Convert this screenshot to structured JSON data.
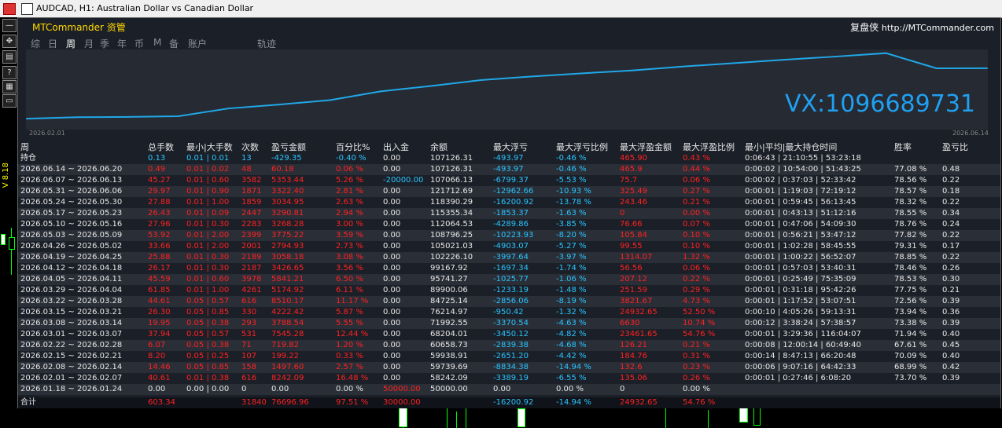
{
  "window": {
    "title": "AUDCAD, H1:  Australian Dollar vs Canadian Dollar"
  },
  "toolbar_buttons": [
    "—",
    "✥",
    "▤",
    "?",
    "▦",
    "▭"
  ],
  "side_text": "V 8.18",
  "panel": {
    "brand": "MTCommander 资管",
    "site_name": "复盘侠",
    "site_url": "http://MTCommander.com",
    "tabs": [
      "综",
      "日",
      "周",
      "月",
      "季",
      "年",
      "币",
      "M",
      "备",
      "账户",
      "轨迹"
    ],
    "active_tab": "周"
  },
  "chart_data": {
    "type": "line",
    "x_ticks": [
      "2026.02.01",
      "2026.06.14"
    ],
    "watermark": "VX:1096689731",
    "x": [
      "2026.02.01",
      "2026.02.08",
      "2026.02.15",
      "2026.02.22",
      "2026.03.01",
      "2026.03.08",
      "2026.03.15",
      "2026.03.22",
      "2026.03.29",
      "2026.04.05",
      "2026.04.12",
      "2026.04.19",
      "2026.04.26",
      "2026.05.03",
      "2026.05.10",
      "2026.05.17",
      "2026.05.24",
      "2026.05.31",
      "2026.06.07",
      "2026.06.14"
    ],
    "values": [
      58242.09,
      59739.69,
      59938.91,
      60658.73,
      68204.01,
      71992.55,
      76214.97,
      84725.14,
      89900.06,
      95741.27,
      99167.92,
      102226.1,
      105021.03,
      108796.25,
      112064.53,
      115355.34,
      118390.29,
      121712.69,
      107066.13,
      107126.31
    ],
    "color": "#20a8e8"
  },
  "table": {
    "headers": [
      "周",
      "总手数",
      "最小|大手数",
      "次数",
      "盈亏金额",
      "百分比%",
      "出入金",
      "余额",
      "最大浮亏",
      "最大浮亏比例",
      "最大浮盈金额",
      "最大浮盈比例",
      "最小|平均|最大持仓时间",
      "胜率",
      "盈亏比"
    ],
    "holding": [
      "持仓",
      "0.13",
      "0.01 | 0.01",
      "13",
      "-429.35",
      "-0.40 %",
      "0.00",
      "107126.31",
      "-493.97",
      "-0.46 %",
      "465.90",
      "0.43 %",
      "0:06:43 | 21:10:55 | 53:23:18",
      "",
      ""
    ],
    "rows": [
      [
        "2026.06.14 ~ 2026.06.20",
        "0.49",
        "0.01 | 0.02",
        "48",
        "60.18",
        "0.06 %",
        "0.00",
        "107126.31",
        "-493.97",
        "-0.46 %",
        "465.9",
        "0.44 %",
        "0:00:02 | 10:54:00 | 51:43:25",
        "77.08 %",
        "0.48"
      ],
      [
        "2026.06.07 ~ 2026.06.13",
        "45.27",
        "0.01 | 0.60",
        "3582",
        "5353.44",
        "5.26 %",
        "-20000.00",
        "107066.13",
        "-6799.37",
        "-5.53 %",
        "75.7",
        "0.06 %",
        "0:00:02 | 0:37:03 | 52:33:42",
        "78.56 %",
        "0.22"
      ],
      [
        "2026.05.31 ~ 2026.06.06",
        "29.97",
        "0.01 | 0.90",
        "1871",
        "3322.40",
        "2.81 %",
        "0.00",
        "121712.69",
        "-12962.66",
        "-10.93 %",
        "325.49",
        "0.27 %",
        "0:00:01 | 1:19:03 | 72:19:12",
        "78.57 %",
        "0.18"
      ],
      [
        "2026.05.24 ~ 2026.05.30",
        "27.88",
        "0.01 | 1.00",
        "1859",
        "3034.95",
        "2.63 %",
        "0.00",
        "118390.29",
        "-16200.92",
        "-13.78 %",
        "243.46",
        "0.21 %",
        "0:00:01 | 0:59:45 | 56:13:45",
        "78.32 %",
        "0.22"
      ],
      [
        "2026.05.17 ~ 2026.05.23",
        "26.43",
        "0.01 | 0.09",
        "2447",
        "3290.81",
        "2.94 %",
        "0.00",
        "115355.34",
        "-1853.37",
        "-1.63 %",
        "0",
        "0.00 %",
        "0:00:01 | 0:43:13 | 51:12:16",
        "78.55 %",
        "0.34"
      ],
      [
        "2026.05.10 ~ 2026.05.16",
        "27.96",
        "0.01 | 0.30",
        "2283",
        "3268.28",
        "3.00 %",
        "0.00",
        "112064.53",
        "-4289.86",
        "-3.85 %",
        "76.66",
        "0.07 %",
        "0:00:01 | 0:47:06 | 54:09:30",
        "78.76 %",
        "0.24"
      ],
      [
        "2026.05.03 ~ 2026.05.09",
        "53.92",
        "0.01 | 2.00",
        "2399",
        "3775.22",
        "3.59 %",
        "0.00",
        "108796.25",
        "-10223.93",
        "-8.20 %",
        "105.84",
        "0.10 %",
        "0:00:01 | 0:56:21 | 53:47:12",
        "77.82 %",
        "0.22"
      ],
      [
        "2026.04.26 ~ 2026.05.02",
        "33.66",
        "0.01 | 2.00",
        "2001",
        "2794.93",
        "2.73 %",
        "0.00",
        "105021.03",
        "-4903.07",
        "-5.27 %",
        "99.55",
        "0.10 %",
        "0:00:01 | 1:02:28 | 58:45:55",
        "79.31 %",
        "0.17"
      ],
      [
        "2026.04.19 ~ 2026.04.25",
        "25.88",
        "0.01 | 0.30",
        "2189",
        "3058.18",
        "3.08 %",
        "0.00",
        "102226.10",
        "-3997.64",
        "-3.97 %",
        "1314.07",
        "1.32 %",
        "0:00:01 | 1:00:22 | 56:52:07",
        "78.85 %",
        "0.22"
      ],
      [
        "2026.04.12 ~ 2026.04.18",
        "26.17",
        "0.01 | 0.30",
        "2187",
        "3426.65",
        "3.56 %",
        "0.00",
        "99167.92",
        "-1697.34",
        "-1.74 %",
        "56.56",
        "0.06 %",
        "0:00:01 | 0:57:03 | 53:40:31",
        "78.46 %",
        "0.26"
      ],
      [
        "2026.04.05 ~ 2026.04.11",
        "45.59",
        "0.01 | 0.60",
        "3978",
        "5841.21",
        "6.50 %",
        "0.00",
        "95741.27",
        "-1025.77",
        "-1.06 %",
        "207.12",
        "0.22 %",
        "0:00:01 | 0:25:49 | 75:35:09",
        "78.53 %",
        "0.30"
      ],
      [
        "2026.03.29 ~ 2026.04.04",
        "61.85",
        "0.01 | 1.00",
        "4261",
        "5174.92",
        "6.11 %",
        "0.00",
        "89900.06",
        "-1233.19",
        "-1.48 %",
        "251.59",
        "0.29 %",
        "0:00:01 | 0:31:18 | 95:42:26",
        "77.75 %",
        "0.21"
      ],
      [
        "2026.03.22 ~ 2026.03.28",
        "44.61",
        "0.05 | 0.57",
        "616",
        "8510.17",
        "11.17 %",
        "0.00",
        "84725.14",
        "-2856.06",
        "-8.19 %",
        "3821.67",
        "4.73 %",
        "0:00:01 | 1:17:52 | 53:07:51",
        "72.56 %",
        "0.39"
      ],
      [
        "2026.03.15 ~ 2026.03.21",
        "26.30",
        "0.05 | 0.85",
        "330",
        "4222.42",
        "5.87 %",
        "0.00",
        "76214.97",
        "-950.42",
        "-1.32 %",
        "24932.65",
        "52.50 %",
        "0:00:10 | 4:05:26 | 59:13:31",
        "73.94 %",
        "0.36"
      ],
      [
        "2026.03.08 ~ 2026.03.14",
        "19.95",
        "0.05 | 0.38",
        "293",
        "3788.54",
        "5.55 %",
        "0.00",
        "71992.55",
        "-3370.54",
        "-4.63 %",
        "6630",
        "10.74 %",
        "0:00:12 | 3:38:24 | 57:38:57",
        "73.38 %",
        "0.39"
      ],
      [
        "2026.03.01 ~ 2026.03.07",
        "37.94",
        "0.05 | 0.57",
        "531",
        "7545.28",
        "12.44 %",
        "0.00",
        "68204.01",
        "-3450.12",
        "-4.82 %",
        "23461.65",
        "54.76 %",
        "0:00:01 | 3:29:36 | 116:04:07",
        "71.94 %",
        "0.40"
      ],
      [
        "2026.02.22 ~ 2026.02.28",
        "6.07",
        "0.05 | 0.38",
        "71",
        "719.82",
        "1.20 %",
        "0.00",
        "60658.73",
        "-2839.38",
        "-4.68 %",
        "126.21",
        "0.21 %",
        "0:00:08 | 12:00:14 | 60:49:40",
        "67.61 %",
        "0.45"
      ],
      [
        "2026.02.15 ~ 2026.02.21",
        "8.20",
        "0.05 | 0.25",
        "107",
        "199.22",
        "0.33 %",
        "0.00",
        "59938.91",
        "-2651.20",
        "-4.42 %",
        "184.76",
        "0.31 %",
        "0:00:14 | 8:47:13 | 66:20:48",
        "70.09 %",
        "0.40"
      ],
      [
        "2026.02.08 ~ 2026.02.14",
        "14.46",
        "0.05 | 0.85",
        "158",
        "1497.60",
        "2.57 %",
        "0.00",
        "59739.69",
        "-8834.38",
        "-14.94 %",
        "132.6",
        "0.23 %",
        "0:00:06 | 9:07:16 | 64:42:33",
        "68.99 %",
        "0.42"
      ],
      [
        "2026.02.01 ~ 2026.02.07",
        "40.61",
        "0.01 | 0.38",
        "616",
        "8242.09",
        "16.48 %",
        "0.00",
        "58242.09",
        "-3389.19",
        "-6.55 %",
        "135.06",
        "0.26 %",
        "0:00:01 | 0:27:46 | 6:08:20",
        "73.70 %",
        "0.39"
      ],
      [
        "2026.01.18 ~ 2026.01.24",
        "0.00",
        "0.00 | 0.00",
        "0",
        "0.00",
        "0.00 %",
        "50000.00",
        "50000.00",
        "0.00",
        "0.00 %",
        "0",
        "0.00 %",
        "",
        "",
        ""
      ]
    ],
    "total": [
      "合计",
      "603.34",
      "",
      "31840",
      "76696.96",
      "97.51 %",
      "30000.00",
      "",
      "-16200.92",
      "-14.94 %",
      "24932.65",
      "54.76 %",
      "",
      "",
      ""
    ]
  },
  "colors": {
    "panel_bg": "#1b1f27",
    "positive": "#ff2222",
    "accent": "#29c5ff",
    "text": "#e8e8e8",
    "brand": "#ffd800"
  }
}
